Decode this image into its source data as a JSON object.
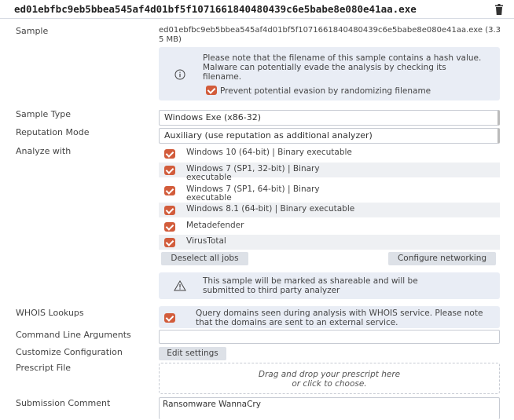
{
  "header": {
    "filename": "ed01ebfbc9eb5bbea545af4d01bf5f1071661840480439c6e5babe8e080e41aa.exe"
  },
  "sample": {
    "label": "Sample",
    "value": "ed01ebfbc9eb5bbea545af4d01bf5f1071661840480439c6e5babe8e080e41aa.exe (3.35 MB)"
  },
  "hash_note": {
    "text": "Please note that the filename of this sample contains a hash value. Malware can potentially evade the analysis by checking its filename.",
    "checkbox_label": "Prevent potential evasion by randomizing filename",
    "checked": true
  },
  "sample_type": {
    "label": "Sample Type",
    "value": "Windows Exe (x86-32)"
  },
  "reputation_mode": {
    "label": "Reputation Mode",
    "value": "Auxiliary (use reputation as additional analyzer)"
  },
  "analyze_with": {
    "label": "Analyze with",
    "jobs": [
      {
        "label": "Windows 10 (64-bit) | Binary executable",
        "checked": true
      },
      {
        "label": "Windows 7 (SP1, 32-bit) | Binary\nexecutable",
        "checked": true
      },
      {
        "label": "Windows 7 (SP1, 64-bit) | Binary\nexecutable",
        "checked": true
      },
      {
        "label": "Windows 8.1 (64-bit) | Binary executable",
        "checked": true
      },
      {
        "label": "Metadefender",
        "checked": true
      },
      {
        "label": "VirusTotal",
        "checked": true
      }
    ],
    "deselect_label": "Deselect all jobs",
    "configure_label": "Configure networking"
  },
  "share_note": {
    "text": "This sample will be marked as shareable and will be submitted to third party analyzer"
  },
  "whois": {
    "label": "WHOIS Lookups",
    "text": "Query domains seen during analysis with WHOIS service. Please note that the domains are sent to an external service.",
    "checked": true
  },
  "command_line": {
    "label": "Command Line Arguments",
    "value": ""
  },
  "customize": {
    "label": "Customize Configuration",
    "button": "Edit settings"
  },
  "prescript": {
    "label": "Prescript File",
    "line1": "Drag and drop your prescript here",
    "line2": "or click to choose."
  },
  "comment": {
    "label": "Submission Comment",
    "value": "Ransomware WannaCry"
  },
  "colors": {
    "checkbox": "#d25c3b",
    "note_bg": "#e9edf5",
    "button_bg": "#dde1e7"
  }
}
